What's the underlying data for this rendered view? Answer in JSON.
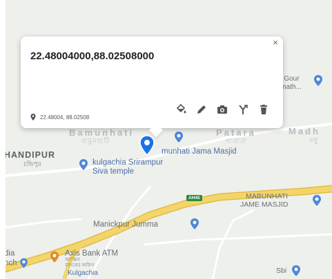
{
  "popup": {
    "title": "22.48004000,88.02508000",
    "coords": "22.48004, 88.02508",
    "close_glyph": "×",
    "tools": [
      "paint-bucket-icon",
      "pencil-icon",
      "camera-icon",
      "merge-icon",
      "trash-icon"
    ]
  },
  "labels": {
    "bamunhati": "Bamunhati",
    "bamunhati_bn": "বামুনহাটি",
    "patara": "Patara",
    "patara_bn": "পাতারা",
    "madh": "Madh",
    "madh_bn": "মধু",
    "sri_gour": "ri Sri Gour",
    "gopinath": "Gopinath...",
    "masjid": "munhati Jama Masjid",
    "handipur": "HANDIPUR",
    "handipur_bn": "চন্ডিপুর",
    "kulgachia_temple_1": "kulgachia Srirampur",
    "kulgachia_temple_2": "Siva temple",
    "road_badge": "AH45",
    "mabunhati_1": "MABUNHATI",
    "mabunhati_2": "JAME MASJID",
    "manickpur": "Manickpur Jumma",
    "axis_bank": "Axis Bank ATM",
    "axis_bank_bn1": "অ্যাক্সিস",
    "axis_bank_bn2": "ব্যাংকের অফিস",
    "dia": "dia",
    "nch": "nch",
    "kulgachia": "Kulgachia",
    "sbi": "Sbi"
  },
  "colors": {
    "map_bg": "#eef0ec",
    "highway": "#f3d56a",
    "highway_edge": "#e2bb45",
    "pin_blue": "#1a73e8",
    "poi_blue": "#4f87d9",
    "road_green": "#2c8a3e"
  }
}
